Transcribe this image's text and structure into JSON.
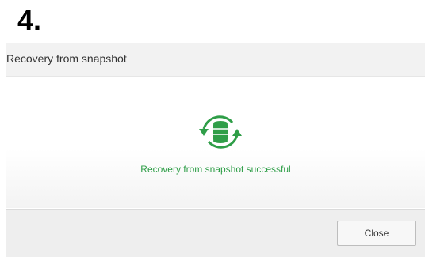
{
  "step_label": "4.",
  "dialog": {
    "title": "Recovery from snapshot",
    "status_icon": "database-sync-icon",
    "status_message": "Recovery from snapshot successful",
    "close_label": "Close"
  },
  "colors": {
    "success": "#2f9e48",
    "header_bg": "#f2f2f2",
    "footer_bg": "#eeeeee"
  }
}
